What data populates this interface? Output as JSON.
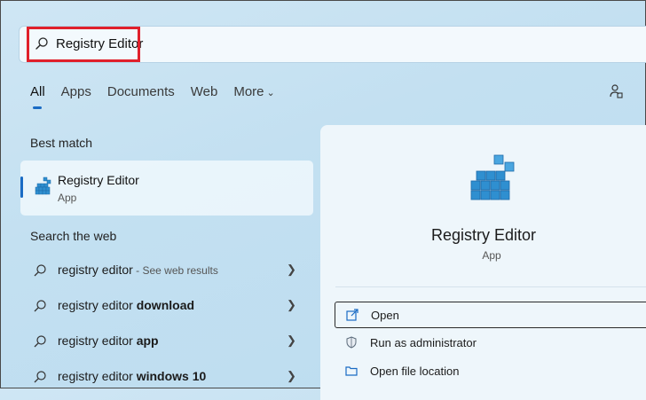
{
  "search": {
    "query": "Registry Editor"
  },
  "tabs": [
    {
      "label": "All"
    },
    {
      "label": "Apps"
    },
    {
      "label": "Documents"
    },
    {
      "label": "Web"
    },
    {
      "label": "More"
    }
  ],
  "best_match": {
    "title": "Best match",
    "name": "Registry Editor",
    "type": "App"
  },
  "web": {
    "title": "Search the web",
    "items": [
      {
        "prefix": "registry editor",
        "bold": "",
        "suffix": " - See web results"
      },
      {
        "prefix": "registry editor ",
        "bold": "download",
        "suffix": ""
      },
      {
        "prefix": "registry editor ",
        "bold": "app",
        "suffix": ""
      },
      {
        "prefix": "registry editor ",
        "bold": "windows 10",
        "suffix": ""
      }
    ]
  },
  "detail": {
    "name": "Registry Editor",
    "type": "App",
    "actions": [
      {
        "label": "Open",
        "icon": "open-icon"
      },
      {
        "label": "Run as administrator",
        "icon": "shield-icon"
      },
      {
        "label": "Open file location",
        "icon": "folder-icon"
      }
    ]
  },
  "colors": {
    "highlight": "#e0202b",
    "accent": "#1a6bc4",
    "registry_blue": "#2f8fd0"
  }
}
